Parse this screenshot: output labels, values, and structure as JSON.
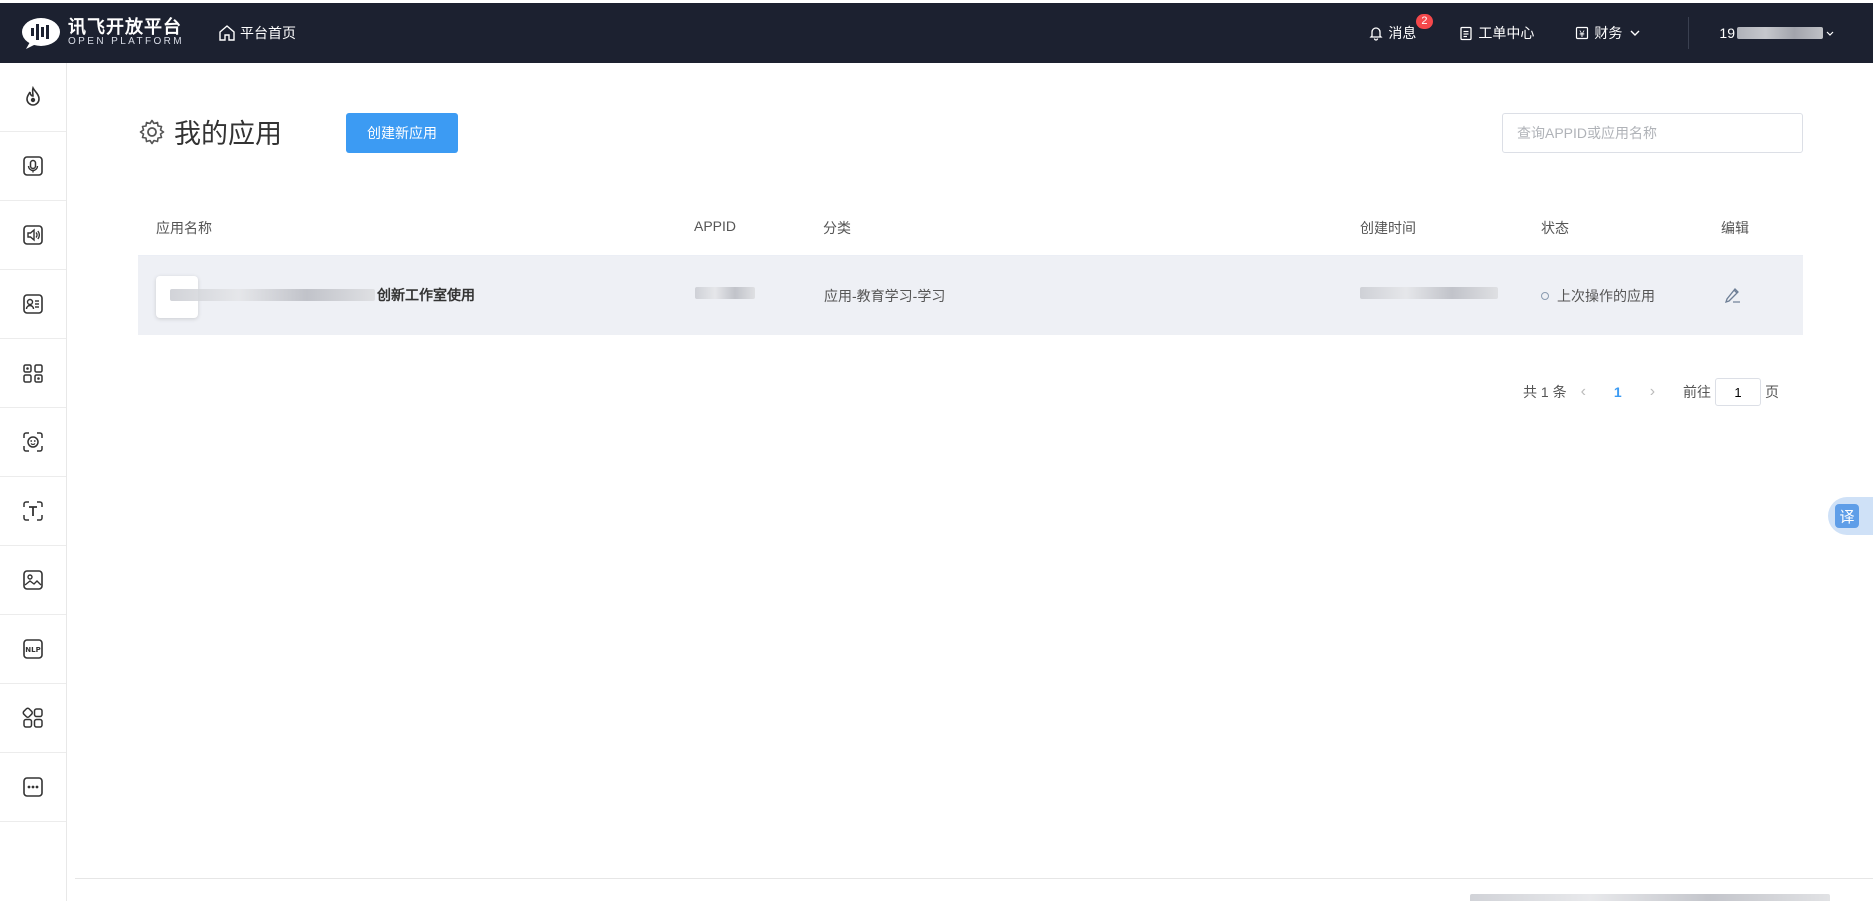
{
  "topbar": {
    "logo_cn": "讯飞开放平台",
    "logo_en": "OPEN PLATFORM",
    "home_label": "平台首页",
    "messages_label": "消息",
    "messages_badge": "2",
    "workorder_label": "工单中心",
    "finance_label": "财务",
    "user_label": "19"
  },
  "sidebar": {
    "items": [
      {
        "icon": "flame-icon"
      },
      {
        "icon": "microphone-icon"
      },
      {
        "icon": "speaker-icon"
      },
      {
        "icon": "voice-document-icon"
      },
      {
        "icon": "translate-compare-icon"
      },
      {
        "icon": "face-scan-icon"
      },
      {
        "icon": "text-scan-icon"
      },
      {
        "icon": "image-icon"
      },
      {
        "icon": "nlp-icon"
      },
      {
        "icon": "apps-grid-icon"
      },
      {
        "icon": "more-icon"
      }
    ]
  },
  "page": {
    "title": "我的应用",
    "create_button": "创建新应用",
    "search_placeholder": "查询APPID或应用名称"
  },
  "table": {
    "headers": {
      "name": "应用名称",
      "appid": "APPID",
      "category": "分类",
      "created": "创建时间",
      "status": "状态",
      "edit": "编辑"
    },
    "rows": [
      {
        "name_visible": "创新工作室使用",
        "category": "应用-教育学习-学习",
        "status": "上次操作的应用"
      }
    ]
  },
  "pagination": {
    "total": "共 1 条",
    "current_page": "1",
    "goto_label": "前往",
    "goto_value": "1",
    "page_suffix": "页"
  },
  "floating": {
    "translate_label": "译"
  },
  "colors": {
    "topbar_bg": "#1c2130",
    "primary": "#3c9bf3",
    "badge": "#f5484b",
    "row_bg": "#eef0f5"
  }
}
